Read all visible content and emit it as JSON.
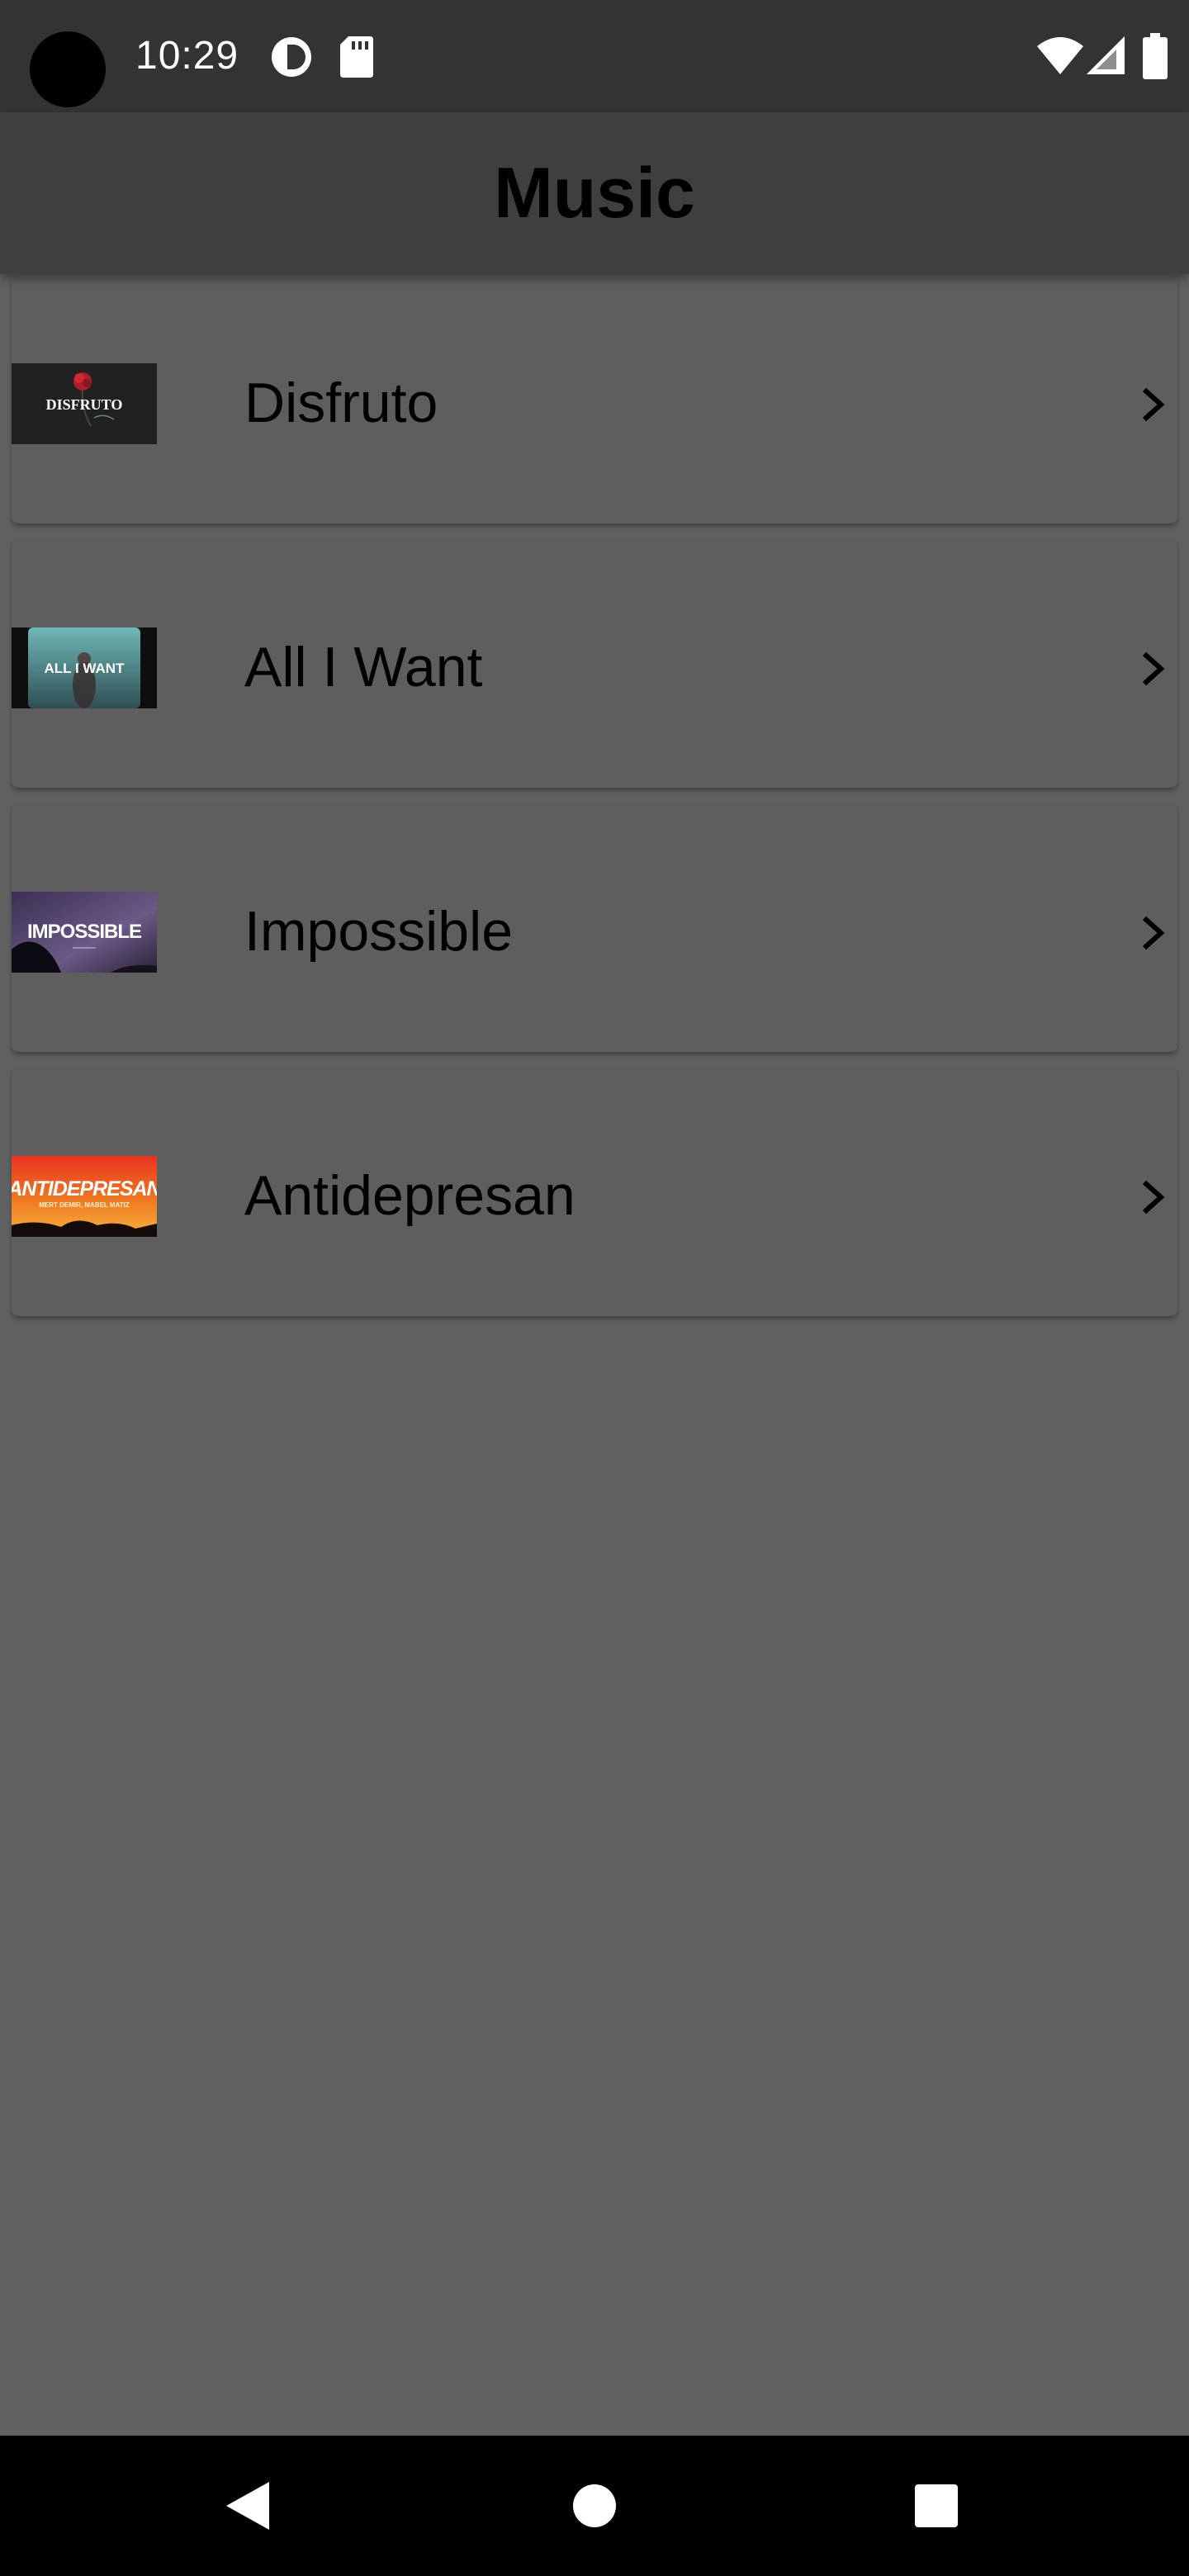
{
  "status_bar": {
    "time": "10:29",
    "icons": [
      "camera-hole",
      "data-saver-icon",
      "sd-card-icon",
      "wifi-icon",
      "cellular-signal-icon",
      "battery-icon"
    ]
  },
  "app_bar": {
    "title": "Music"
  },
  "songs": [
    {
      "title": "Disfruto",
      "thumbnail_text": "DISFRUTO",
      "thumbnail_icon": "rose-icon"
    },
    {
      "title": "All I Want",
      "thumbnail_text": "ALL I WANT"
    },
    {
      "title": "Impossible",
      "thumbnail_text": "IMPOSSIBLE"
    },
    {
      "title": "Antidepresan",
      "thumbnail_text": "ANTIDEPRESAN",
      "thumbnail_subtext": "MERT DEMIR, MABEL MATIZ"
    }
  ],
  "nav_bar": {
    "back_icon": "back-triangle-icon",
    "home_icon": "home-circle-icon",
    "recents_icon": "recents-square-icon"
  },
  "colors": {
    "background": "#616161",
    "status_bar": "#333333",
    "app_bar": "#3f3f3f",
    "card": "#5e5e5e",
    "nav_bar": "#000000"
  }
}
